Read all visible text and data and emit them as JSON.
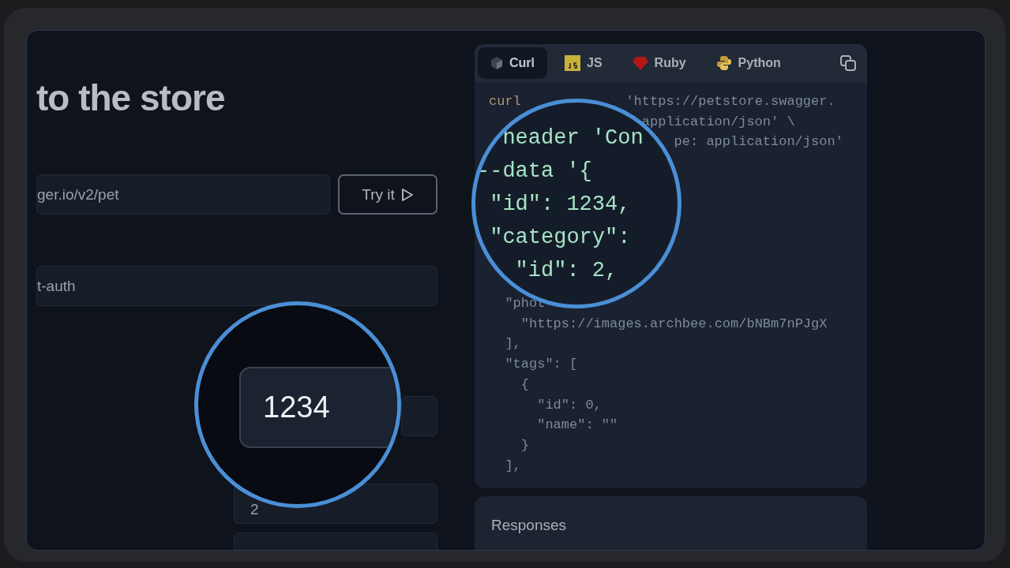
{
  "page": {
    "title": "to the store",
    "url_field": {
      "value": "ger.io/v2/pet"
    },
    "try_button": {
      "label": "Try it"
    },
    "auth_field": {
      "value": "t-auth"
    },
    "param_field": {
      "value": "2"
    },
    "magnifier": {
      "value": "1234"
    }
  },
  "code_panel": {
    "tabs": [
      {
        "label": "Curl",
        "selected": true,
        "kind": "cube"
      },
      {
        "label": "JS",
        "selected": false,
        "kind": "js"
      },
      {
        "label": "Ruby",
        "selected": false,
        "kind": "ruby"
      },
      {
        "label": "Python",
        "selected": false,
        "kind": "python"
      }
    ],
    "lines_top": [
      {
        "kind": "command",
        "segments": [
          "curl",
          "             'https://petstore.swagger."
        ]
      },
      {
        "kind": "plain",
        "segments": [
          "                   application/json' \\"
        ]
      },
      {
        "kind": "plain",
        "segments": [
          "                       pe: application/json'"
        ]
      }
    ],
    "lines_bottom": [
      {
        "kind": "plain",
        "segments": [
          "  \"phot"
        ]
      },
      {
        "kind": "plain",
        "segments": [
          "    \"https://images.archbee.com/bNBm7nPJgX"
        ]
      },
      {
        "kind": "plain",
        "segments": [
          "  ],"
        ]
      },
      {
        "kind": "plain",
        "segments": [
          "  \"tags\": ["
        ]
      },
      {
        "kind": "plain",
        "segments": [
          "    {"
        ]
      },
      {
        "kind": "plain",
        "segments": [
          "      \"id\": 0,"
        ]
      },
      {
        "kind": "plain",
        "segments": [
          "      \"name\": \"\""
        ]
      },
      {
        "kind": "plain",
        "segments": [
          "    }"
        ]
      },
      {
        "kind": "plain",
        "segments": [
          "  ],"
        ]
      }
    ],
    "magnifier_lines": [
      "  header 'Con",
      "--data '{",
      " \"id\": 1234,",
      " \"category\":",
      "   \"id\": 2,"
    ]
  },
  "responses": {
    "title": "Responses"
  }
}
